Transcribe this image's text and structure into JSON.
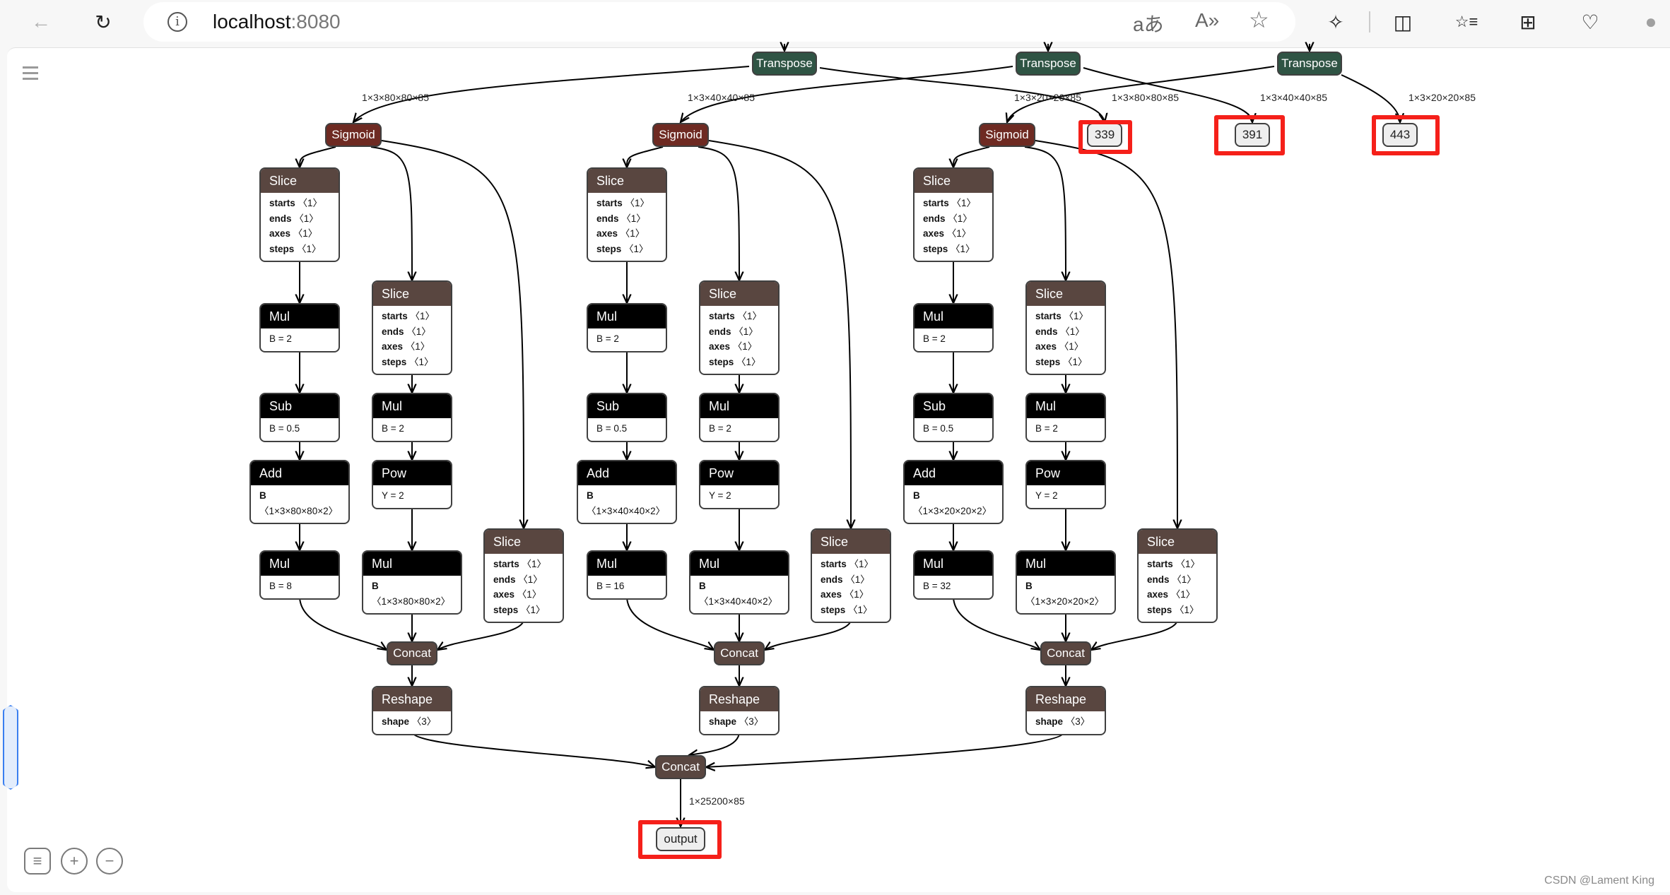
{
  "browser": {
    "url_host": "localhost",
    "url_port": ":8080",
    "icons": {
      "back": "back-arrow-icon",
      "reload": "reload-icon",
      "info": "site-info-icon",
      "translate": "translate-icon",
      "read_aloud": "read-aloud-icon",
      "favorite": "favorite-star-icon",
      "extensions": "extensions-icon",
      "split_screen": "split-screen-icon",
      "favorites": "favorites-list-icon",
      "collections": "collections-icon",
      "browser_essentials": "browser-essentials-icon",
      "profile": "profile-avatar-icon"
    },
    "glyphs": {
      "back": "←",
      "reload": "↻",
      "info": "i",
      "translate": "aあ",
      "read_aloud": "A»",
      "favorite": "☆",
      "extensions": "✧",
      "split_screen": "◫",
      "favorites": "☆≡",
      "collections": "⊞",
      "browser_essentials": "♡",
      "profile": "●"
    }
  },
  "graph": {
    "colors": {
      "transpose": "#2f5444",
      "sigmoid": "#6e2a22",
      "layer": "#594640",
      "math": "#000000",
      "highlight": "#f5201a",
      "io_fill": "#eeeeee"
    },
    "transpose_nodes": [
      "Transpose",
      "Transpose",
      "Transpose"
    ],
    "outputs_top": [
      "339",
      "391",
      "443"
    ],
    "top_edge_labels": [
      "1×3×80×80×85",
      "1×3×40×40×85",
      "1×3×20×20×85",
      "1×3×80×80×85",
      "1×3×40×40×85",
      "1×3×20×20×85"
    ],
    "branches": [
      {
        "sigmoid": "Sigmoid",
        "slice_a": {
          "title": "Slice",
          "attrs": [
            [
              "starts",
              "〈1〉"
            ],
            [
              "ends",
              "〈1〉"
            ],
            [
              "axes",
              "〈1〉"
            ],
            [
              "steps",
              "〈1〉"
            ]
          ]
        },
        "mul1": {
          "title": "Mul",
          "attr": "B = 2"
        },
        "sub": {
          "title": "Sub",
          "attr": "B = 0.5"
        },
        "add": {
          "title": "Add",
          "attr_key": "B",
          "attr_val": "〈1×3×80×80×2〉"
        },
        "mul_stride": {
          "title": "Mul",
          "attr": "B = 8"
        },
        "slice_b": {
          "title": "Slice",
          "attrs": [
            [
              "starts",
              "〈1〉"
            ],
            [
              "ends",
              "〈1〉"
            ],
            [
              "axes",
              "〈1〉"
            ],
            [
              "steps",
              "〈1〉"
            ]
          ]
        },
        "mul2": {
          "title": "Mul",
          "attr": "B = 2"
        },
        "pow": {
          "title": "Pow",
          "attr": "Y = 2"
        },
        "mul_anchor": {
          "title": "Mul",
          "attr_key": "B",
          "attr_val": "〈1×3×80×80×2〉"
        },
        "slice_c": {
          "title": "Slice",
          "attrs": [
            [
              "starts",
              "〈1〉"
            ],
            [
              "ends",
              "〈1〉"
            ],
            [
              "axes",
              "〈1〉"
            ],
            [
              "steps",
              "〈1〉"
            ]
          ]
        },
        "concat": "Concat",
        "reshape": {
          "title": "Reshape",
          "attr_key": "shape",
          "attr_val": "〈3〉"
        }
      },
      {
        "sigmoid": "Sigmoid",
        "slice_a": {
          "title": "Slice",
          "attrs": [
            [
              "starts",
              "〈1〉"
            ],
            [
              "ends",
              "〈1〉"
            ],
            [
              "axes",
              "〈1〉"
            ],
            [
              "steps",
              "〈1〉"
            ]
          ]
        },
        "mul1": {
          "title": "Mul",
          "attr": "B = 2"
        },
        "sub": {
          "title": "Sub",
          "attr": "B = 0.5"
        },
        "add": {
          "title": "Add",
          "attr_key": "B",
          "attr_val": "〈1×3×40×40×2〉"
        },
        "mul_stride": {
          "title": "Mul",
          "attr": "B = 16"
        },
        "slice_b": {
          "title": "Slice",
          "attrs": [
            [
              "starts",
              "〈1〉"
            ],
            [
              "ends",
              "〈1〉"
            ],
            [
              "axes",
              "〈1〉"
            ],
            [
              "steps",
              "〈1〉"
            ]
          ]
        },
        "mul2": {
          "title": "Mul",
          "attr": "B = 2"
        },
        "pow": {
          "title": "Pow",
          "attr": "Y = 2"
        },
        "mul_anchor": {
          "title": "Mul",
          "attr_key": "B",
          "attr_val": "〈1×3×40×40×2〉"
        },
        "slice_c": {
          "title": "Slice",
          "attrs": [
            [
              "starts",
              "〈1〉"
            ],
            [
              "ends",
              "〈1〉"
            ],
            [
              "axes",
              "〈1〉"
            ],
            [
              "steps",
              "〈1〉"
            ]
          ]
        },
        "concat": "Concat",
        "reshape": {
          "title": "Reshape",
          "attr_key": "shape",
          "attr_val": "〈3〉"
        }
      },
      {
        "sigmoid": "Sigmoid",
        "slice_a": {
          "title": "Slice",
          "attrs": [
            [
              "starts",
              "〈1〉"
            ],
            [
              "ends",
              "〈1〉"
            ],
            [
              "axes",
              "〈1〉"
            ],
            [
              "steps",
              "〈1〉"
            ]
          ]
        },
        "mul1": {
          "title": "Mul",
          "attr": "B = 2"
        },
        "sub": {
          "title": "Sub",
          "attr": "B = 0.5"
        },
        "add": {
          "title": "Add",
          "attr_key": "B",
          "attr_val": "〈1×3×20×20×2〉"
        },
        "mul_stride": {
          "title": "Mul",
          "attr": "B = 32"
        },
        "slice_b": {
          "title": "Slice",
          "attrs": [
            [
              "starts",
              "〈1〉"
            ],
            [
              "ends",
              "〈1〉"
            ],
            [
              "axes",
              "〈1〉"
            ],
            [
              "steps",
              "〈1〉"
            ]
          ]
        },
        "mul2": {
          "title": "Mul",
          "attr": "B = 2"
        },
        "pow": {
          "title": "Pow",
          "attr": "Y = 2"
        },
        "mul_anchor": {
          "title": "Mul",
          "attr_key": "B",
          "attr_val": "〈1×3×20×20×2〉"
        },
        "slice_c": {
          "title": "Slice",
          "attrs": [
            [
              "starts",
              "〈1〉"
            ],
            [
              "ends",
              "〈1〉"
            ],
            [
              "axes",
              "〈1〉"
            ],
            [
              "steps",
              "〈1〉"
            ]
          ]
        },
        "concat": "Concat",
        "reshape": {
          "title": "Reshape",
          "attr_key": "shape",
          "attr_val": "〈3〉"
        }
      }
    ],
    "final_concat": "Concat",
    "final_edge_label": "1×25200×85",
    "final_output": "output"
  },
  "controls": {
    "menu_icon": "hamburger-menu-icon",
    "list_icon": "list-view-icon",
    "zoom_in_icon": "zoom-in-icon",
    "zoom_out_icon": "zoom-out-icon"
  },
  "watermark": "CSDN @Lament King"
}
